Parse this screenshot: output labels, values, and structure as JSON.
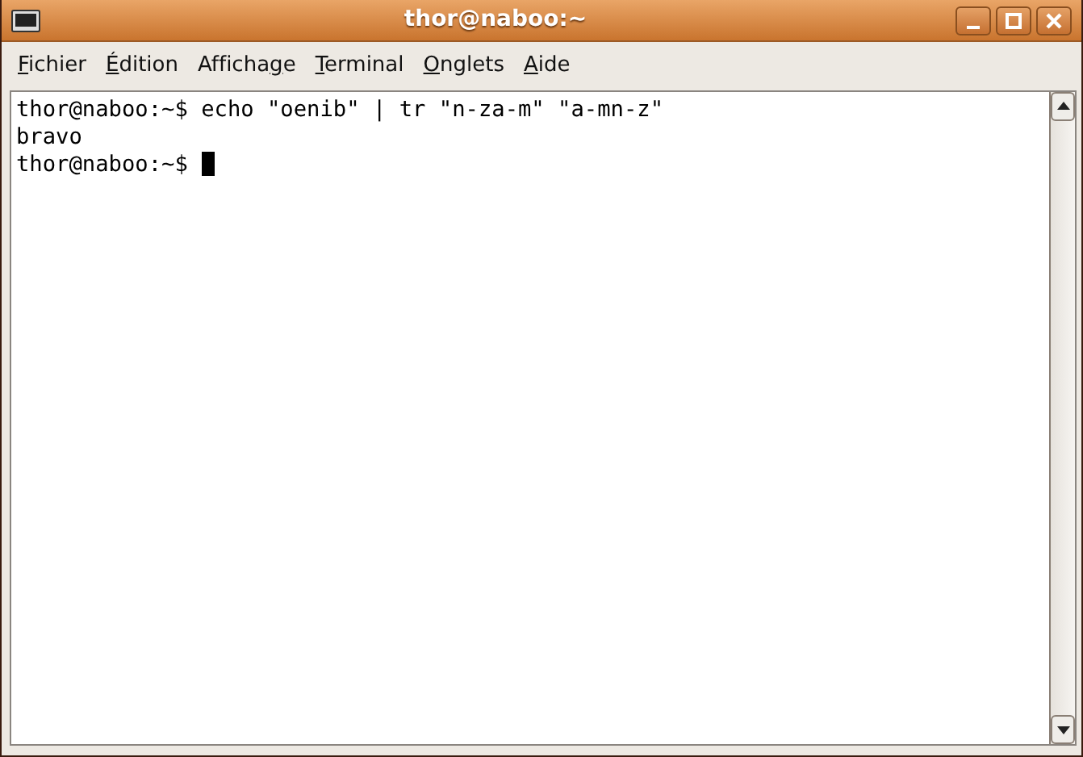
{
  "window": {
    "title": "thor@naboo:~"
  },
  "menu": [
    {
      "mnemonic": "F",
      "label_rest": "ichier"
    },
    {
      "mnemonic": "É",
      "label_rest": "dition"
    },
    {
      "label_start": "Afficha",
      "mnemonic": "g",
      "label_rest": "e"
    },
    {
      "mnemonic": "T",
      "label_rest": "erminal"
    },
    {
      "mnemonic": "O",
      "label_rest": "nglets"
    },
    {
      "mnemonic": "A",
      "label_rest": "ide"
    }
  ],
  "terminal": {
    "lines": [
      "thor@naboo:~$ echo \"oenib\" | tr \"n-za-m\" \"a-mn-z\"",
      "bravo",
      "thor@naboo:~$ "
    ],
    "cursor": true
  }
}
